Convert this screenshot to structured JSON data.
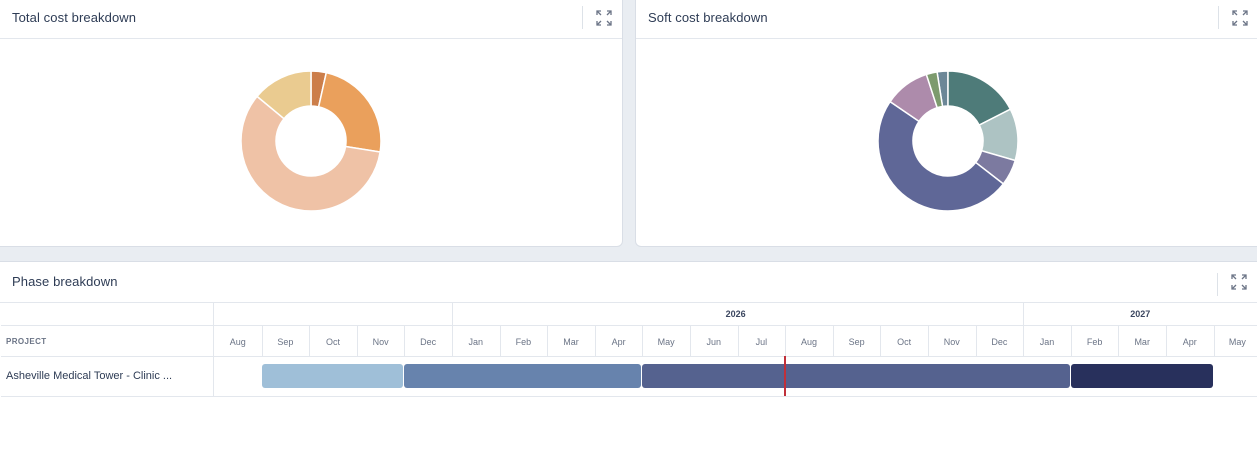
{
  "cards": {
    "total": {
      "title": "Total cost breakdown"
    },
    "soft": {
      "title": "Soft cost breakdown"
    },
    "phase": {
      "title": "Phase breakdown"
    }
  },
  "icons": {
    "expand": "expand-icon"
  },
  "total_donut": {
    "slices": [
      {
        "value": 3.5,
        "color": "#cc7e4a"
      },
      {
        "value": 24,
        "color": "#eaa05c"
      },
      {
        "value": 58.5,
        "color": "#efc2a6"
      },
      {
        "value": 14,
        "color": "#eacb90"
      }
    ]
  },
  "soft_donut": {
    "slices": [
      {
        "value": 2.5,
        "color": "#6c8797"
      },
      {
        "value": 17.5,
        "color": "#4e7b79"
      },
      {
        "value": 12,
        "color": "#adc3c3"
      },
      {
        "value": 6,
        "color": "#7c7aa0"
      },
      {
        "value": 49,
        "color": "#5f6797"
      },
      {
        "value": 10.5,
        "color": "#ad8bab"
      },
      {
        "value": 2.5,
        "color": "#7d9b6e"
      }
    ]
  },
  "phase": {
    "project_column_header": "PROJECT",
    "years": [
      "2026",
      "2027"
    ],
    "months": [
      "Aug",
      "Sep",
      "Oct",
      "Nov",
      "Dec",
      "Jan",
      "Feb",
      "Mar",
      "Apr",
      "May",
      "Jun",
      "Jul",
      "Aug",
      "Sep",
      "Oct",
      "Nov",
      "Dec",
      "Jan",
      "Feb",
      "Mar",
      "Apr",
      "May"
    ],
    "projects": [
      {
        "name": "Asheville Medical Tower - Clinic ...",
        "phases": [
          {
            "start": 1,
            "end": 4,
            "color": "#9fbfd8"
          },
          {
            "start": 4,
            "end": 9,
            "color": "#6783ad"
          },
          {
            "start": 9,
            "end": 18,
            "color": "#55628f"
          },
          {
            "start": 18,
            "end": 21,
            "color": "#28305c"
          }
        ]
      }
    ],
    "today_month_index": 12
  }
}
